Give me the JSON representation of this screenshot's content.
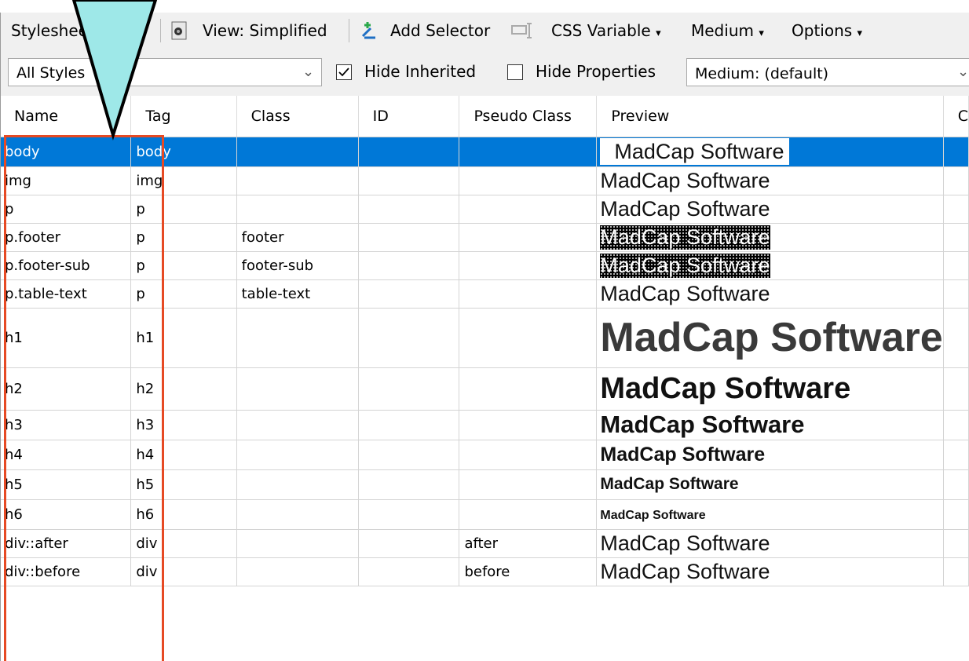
{
  "toolbar": {
    "stylesheet_editor_label": "Stylesheet Editor",
    "view_label": "View: Simplified",
    "add_selector_label": "Add Selector",
    "css_variable_label": "CSS Variable",
    "medium_label": "Medium",
    "options_label": "Options"
  },
  "filters": {
    "styles_filter_value": "All Styles",
    "hide_inherited_label": "Hide Inherited",
    "hide_inherited_checked": true,
    "hide_properties_label": "Hide Properties",
    "hide_properties_checked": false,
    "medium_select_value": "Medium: (default)"
  },
  "grid": {
    "columns": [
      "Name",
      "Tag",
      "Class",
      "ID",
      "Pseudo Class",
      "Preview",
      "C"
    ],
    "preview_text": "MadCap Software",
    "rows": [
      {
        "name": "body",
        "tag": "body",
        "class": "",
        "id": "",
        "pseudo": "",
        "preview_style": "body",
        "selected": true
      },
      {
        "name": "img",
        "tag": "img",
        "class": "",
        "id": "",
        "pseudo": "",
        "preview_style": "normal"
      },
      {
        "name": "p",
        "tag": "p",
        "class": "",
        "id": "",
        "pseudo": "",
        "preview_style": "normal"
      },
      {
        "name": "p.footer",
        "tag": "p",
        "class": "footer",
        "id": "",
        "pseudo": "",
        "preview_style": "dark"
      },
      {
        "name": "p.footer-sub",
        "tag": "p",
        "class": "footer-sub",
        "id": "",
        "pseudo": "",
        "preview_style": "dark"
      },
      {
        "name": "p.table-text",
        "tag": "p",
        "class": "table-text",
        "id": "",
        "pseudo": "",
        "preview_style": "normal"
      },
      {
        "name": "h1",
        "tag": "h1",
        "class": "",
        "id": "",
        "pseudo": "",
        "preview_style": "h1"
      },
      {
        "name": "h2",
        "tag": "h2",
        "class": "",
        "id": "",
        "pseudo": "",
        "preview_style": "h2"
      },
      {
        "name": "h3",
        "tag": "h3",
        "class": "",
        "id": "",
        "pseudo": "",
        "preview_style": "h3"
      },
      {
        "name": "h4",
        "tag": "h4",
        "class": "",
        "id": "",
        "pseudo": "",
        "preview_style": "h4"
      },
      {
        "name": "h5",
        "tag": "h5",
        "class": "",
        "id": "",
        "pseudo": "",
        "preview_style": "h5"
      },
      {
        "name": "h6",
        "tag": "h6",
        "class": "",
        "id": "",
        "pseudo": "",
        "preview_style": "h6"
      },
      {
        "name": "div::after",
        "tag": "div",
        "class": "",
        "id": "",
        "pseudo": "after",
        "preview_style": "normal"
      },
      {
        "name": "div::before",
        "tag": "div",
        "class": "",
        "id": "",
        "pseudo": "before",
        "preview_style": "normal"
      }
    ]
  },
  "annotation": {
    "highlight_color": "#e64a24",
    "callout_color": "#9ee8e8"
  },
  "colors": {
    "selection": "#0078d7",
    "toolbar_bg": "#f0f0f0"
  }
}
